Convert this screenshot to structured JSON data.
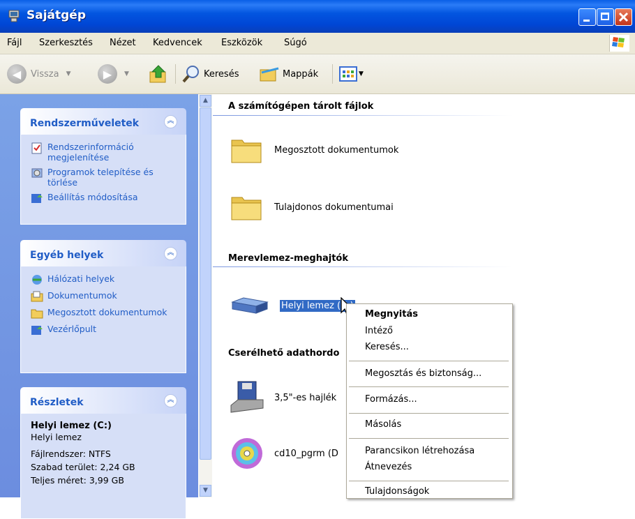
{
  "window": {
    "title": "Sajátgép"
  },
  "menu": [
    "Fájl",
    "Szerkesztés",
    "Nézet",
    "Kedvencek",
    "Eszközök",
    "Súgó"
  ],
  "toolbar": {
    "back": "Vissza",
    "search": "Keresés",
    "folders": "Mappák"
  },
  "sidebar": {
    "system_tasks": {
      "title": "Rendszerműveletek",
      "items": [
        "Rendszerinformáció megjelenítése",
        "Programok telepítése és törlése",
        "Beállítás módosítása"
      ]
    },
    "other_places": {
      "title": "Egyéb helyek",
      "items": [
        "Hálózati helyek",
        "Dokumentumok",
        "Megosztott dokumentumok",
        "Vezérlőpult"
      ]
    },
    "details": {
      "title": "Részletek",
      "name": "Helyi lemez (C:)",
      "type": "Helyi lemez",
      "filesystem": "Fájlrendszer: NTFS",
      "free": "Szabad terület: 2,24 GB",
      "total": "Teljes méret: 3,99 GB"
    }
  },
  "content": {
    "groups": {
      "files": "A számítógépen tárolt fájlok",
      "hdd": "Merevlemez-meghajtók",
      "removable": "Cserélhető adathordo"
    },
    "items": {
      "shared_docs": "Megosztott dokumentumok",
      "owner_docs": "Tulajdonos dokumentumai",
      "local_disk": "Helyi lemez (C:)",
      "floppy": "3,5\"-es hajlék",
      "cd": "cd10_pgrm (D"
    }
  },
  "context_menu": {
    "open": "Megnyitás",
    "explore": "Intéző",
    "search": "Keresés...",
    "sharing": "Megosztás és biztonság...",
    "format": "Formázás...",
    "copy": "Másolás",
    "shortcut": "Parancsikon létrehozása",
    "rename": "Átnevezés",
    "properties": "Tulajdonságok"
  }
}
